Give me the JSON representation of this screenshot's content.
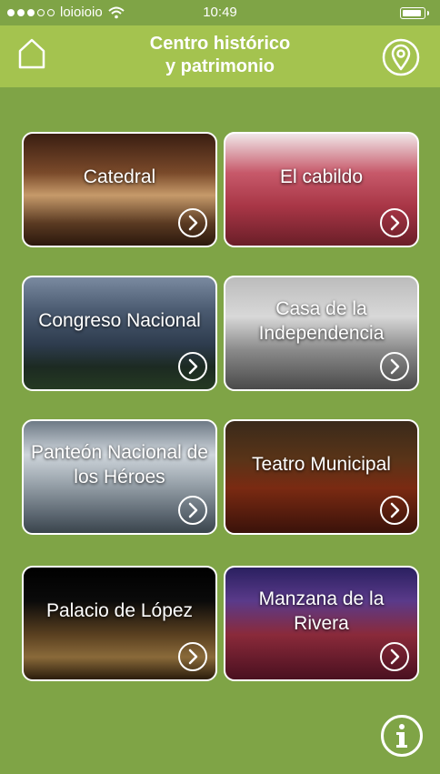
{
  "status_bar": {
    "carrier": "loioioio",
    "time": "10:49"
  },
  "header": {
    "title_line1": "Centro histórico",
    "title_line2": "y patrimonio"
  },
  "icons": {
    "home": "home-icon",
    "location": "location-pin-icon",
    "play": "play-circle-icon",
    "info": "info-icon"
  },
  "colors": {
    "background": "#7fa446",
    "header": "#a4c34f",
    "text": "#ffffff"
  },
  "places": [
    {
      "label": "Catedral",
      "bg": "linear-gradient(180deg,#3a1e12 0%,#7a4a2a 35%,#c69a6a 55%,#5a3a22 80%,#2b180d 100%)"
    },
    {
      "label": "El cabildo",
      "bg": "linear-gradient(180deg,#f0e6e8 0%,#c7596a 35%,#a83646 65%,#6a1e28 100%)"
    },
    {
      "label": "Congreso Nacional",
      "bg": "linear-gradient(180deg,#7a8aa0 0%,#4a5a70 30%,#2e3c4e 60%,#1c2a22 80%,#253a22 100%)"
    },
    {
      "label": "Casa de la Independencia",
      "bg": "linear-gradient(180deg,#bcbcbc 0%,#d8d8d8 35%,#8a8a8a 65%,#4a4a4a 100%)"
    },
    {
      "label": "Panteón Nacional de los Héroes",
      "bg": "linear-gradient(180deg,#6e7a86 0%,#cfd6dc 30%,#9aa4ac 55%,#59646e 85%,#3a444c 100%)"
    },
    {
      "label": "Teatro Municipal",
      "bg": "linear-gradient(180deg,#3a2a1a 0%,#5a3418 35%,#7a2a12 60%,#3a120a 100%)"
    },
    {
      "label": "Palacio de López",
      "bg": "linear-gradient(180deg,#000000 0%,#0a0a0a 30%,#5a4020 60%,#8a6a3a 80%,#2a1c0c 100%)"
    },
    {
      "label": "Manzana de la Rivera",
      "bg": "linear-gradient(180deg,#2a2060 0%,#5a3a8a 30%,#8a2a3a 60%,#4a1020 100%)"
    }
  ]
}
